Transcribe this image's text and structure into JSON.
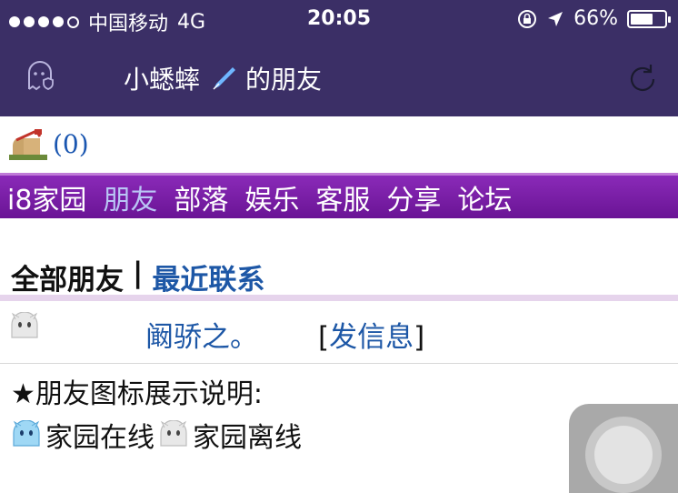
{
  "status_bar": {
    "carrier": "中国移动",
    "network": "4G",
    "time": "20:05",
    "battery": "66%",
    "battery_level": 0.66
  },
  "nav": {
    "title_part1": "小蟋蟀",
    "title_part2": "的朋友"
  },
  "messages": {
    "count": "(0)"
  },
  "menu": {
    "items": [
      "i8家园",
      "朋友",
      "部落",
      "娱乐",
      "客服",
      "分享",
      "论坛"
    ],
    "active_index": 1
  },
  "tabs": {
    "all": "全部朋友",
    "separator": "|",
    "recent": "最近联系"
  },
  "friends": [
    {
      "name": "阚骄之。",
      "action_open": "[",
      "action": "发信息",
      "action_close": "]"
    }
  ],
  "legend": {
    "title": "★朋友图标展示说明:",
    "online": "家园在线",
    "offline": "家园离线"
  },
  "colors": {
    "header": "#3b2f66",
    "menu": "#7a1ea6",
    "link": "#1d57a6"
  }
}
